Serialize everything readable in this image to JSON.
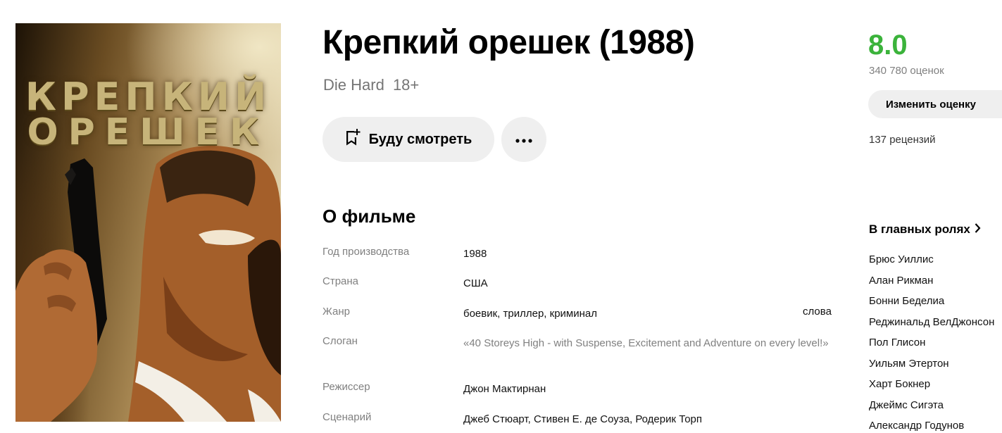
{
  "poster": {
    "title_line1": "КРЕПКИЙ",
    "title_line2": "ОРЕШЕК"
  },
  "movie": {
    "title": "Крепкий орешек (1988)",
    "original_title": "Die Hard",
    "age_rating": "18+"
  },
  "actions": {
    "watch_later_label": "Буду смотреть",
    "watch_later_icon": "bookmark-plus-icon",
    "more_icon": "more-dots-icon"
  },
  "about": {
    "heading": "О фильме",
    "rows": [
      {
        "label": "Год производства",
        "value": "1988"
      },
      {
        "label": "Страна",
        "value": "США"
      },
      {
        "label": "Жанр",
        "value": "боевик, триллер, криминал",
        "extra": "слова"
      },
      {
        "label": "Слоган",
        "value": "«40 Storeys High - with Suspense, Excitement and Adventure on every level!»"
      },
      {
        "label": "Режиссер",
        "value": "Джон Мактирнан"
      },
      {
        "label": "Сценарий",
        "value": "Джеб Стюарт, Стивен Е. де Соуза, Родерик Торп"
      }
    ]
  },
  "rating": {
    "score": "8.0",
    "votes": "340 780 оценок",
    "rate_button_label": "Изменить оценку",
    "reviews": "137 рецензий",
    "score_color": "#3bb33b"
  },
  "cast": {
    "heading": "В главных ролях",
    "items": [
      "Брюс Уиллис",
      "Алан Рикман",
      "Бонни Беделиа",
      "Реджинальд ВелДжонсон",
      "Пол Глисон",
      "Уильям Этертон",
      "Харт Бокнер",
      "Джеймс Сигэта",
      "Александр Годунов"
    ]
  }
}
